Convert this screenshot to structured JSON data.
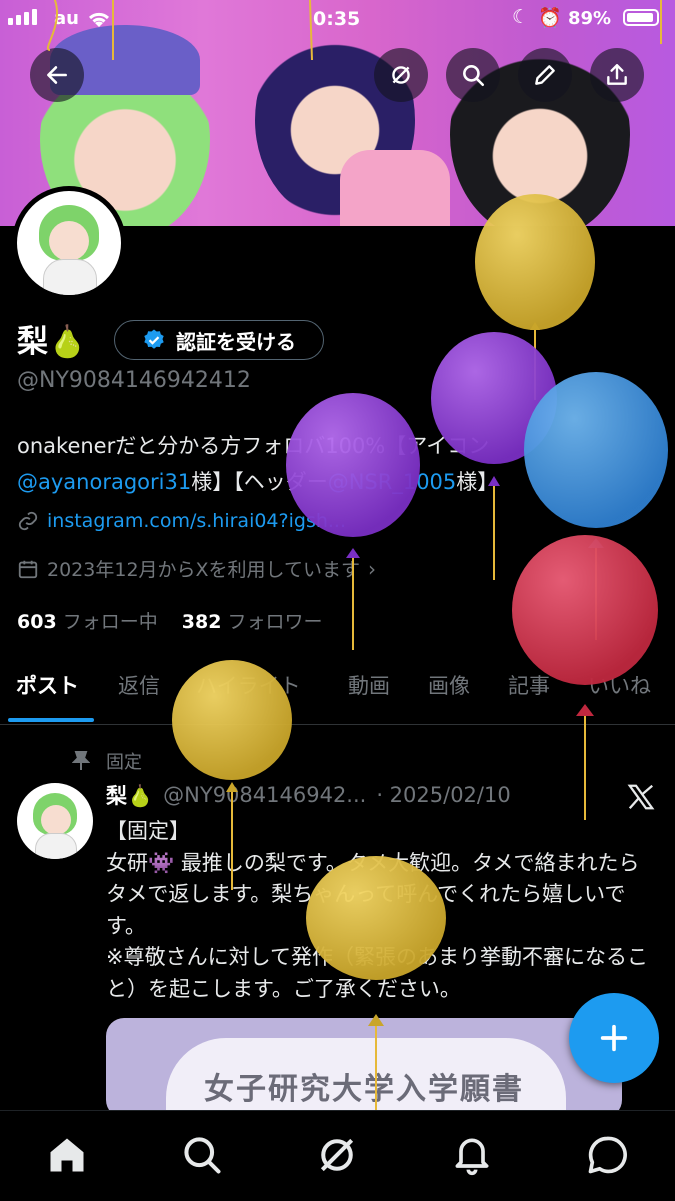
{
  "status_bar": {
    "carrier": "au",
    "time": "0:35",
    "battery": "89%"
  },
  "header": {
    "back_icon": "arrow-left-icon",
    "actions": [
      "grok-icon",
      "search-icon",
      "edit-icon",
      "share-icon"
    ]
  },
  "profile": {
    "display_name": "梨🍐",
    "verify_button": "認証を受ける",
    "handle": "@NY9084146942412",
    "bio_part1": "onakenerだと分かる方フォロバ100%【アイコン",
    "bio_mention1": "@ayanoragori31",
    "bio_part2": "様】【ヘッダー",
    "bio_mention2": "@NSR_1005",
    "bio_part3": "様】",
    "link": "instagram.com/s.hirai04?igsh...",
    "joined": "2023年12月からXを利用しています",
    "following_count": "603",
    "following_label": "フォロー中",
    "followers_count": "382",
    "followers_label": "フォロワー"
  },
  "tabs": [
    "ポスト",
    "返信",
    "ハイライト",
    "動画",
    "画像",
    "記事",
    "いいね"
  ],
  "active_tab": "ポスト",
  "pinned_post": {
    "pinned_label": "固定",
    "author_name": "梨🍐",
    "author_handle": "@NY90841469​42...",
    "date": "· 2025/02/10",
    "text_line1": "【固定】",
    "text_body": "女研👾 最推しの梨です。タメ大歓迎。タメで絡まれたらタメで返します。梨ちゃんって呼んでくれたら嬉しいです。",
    "text_body2": "※尊敬さんに対して発作（緊張のあまり挙動不審になること）を起こします。ご了承ください。",
    "image_text": "女子研究大学入学願書"
  },
  "bottom_nav": [
    "home-icon",
    "search-icon",
    "grok-icon",
    "notifications-icon",
    "messages-icon"
  ],
  "colors": {
    "accent": "#1d9bf0",
    "background": "#000000",
    "muted": "#71767b"
  }
}
